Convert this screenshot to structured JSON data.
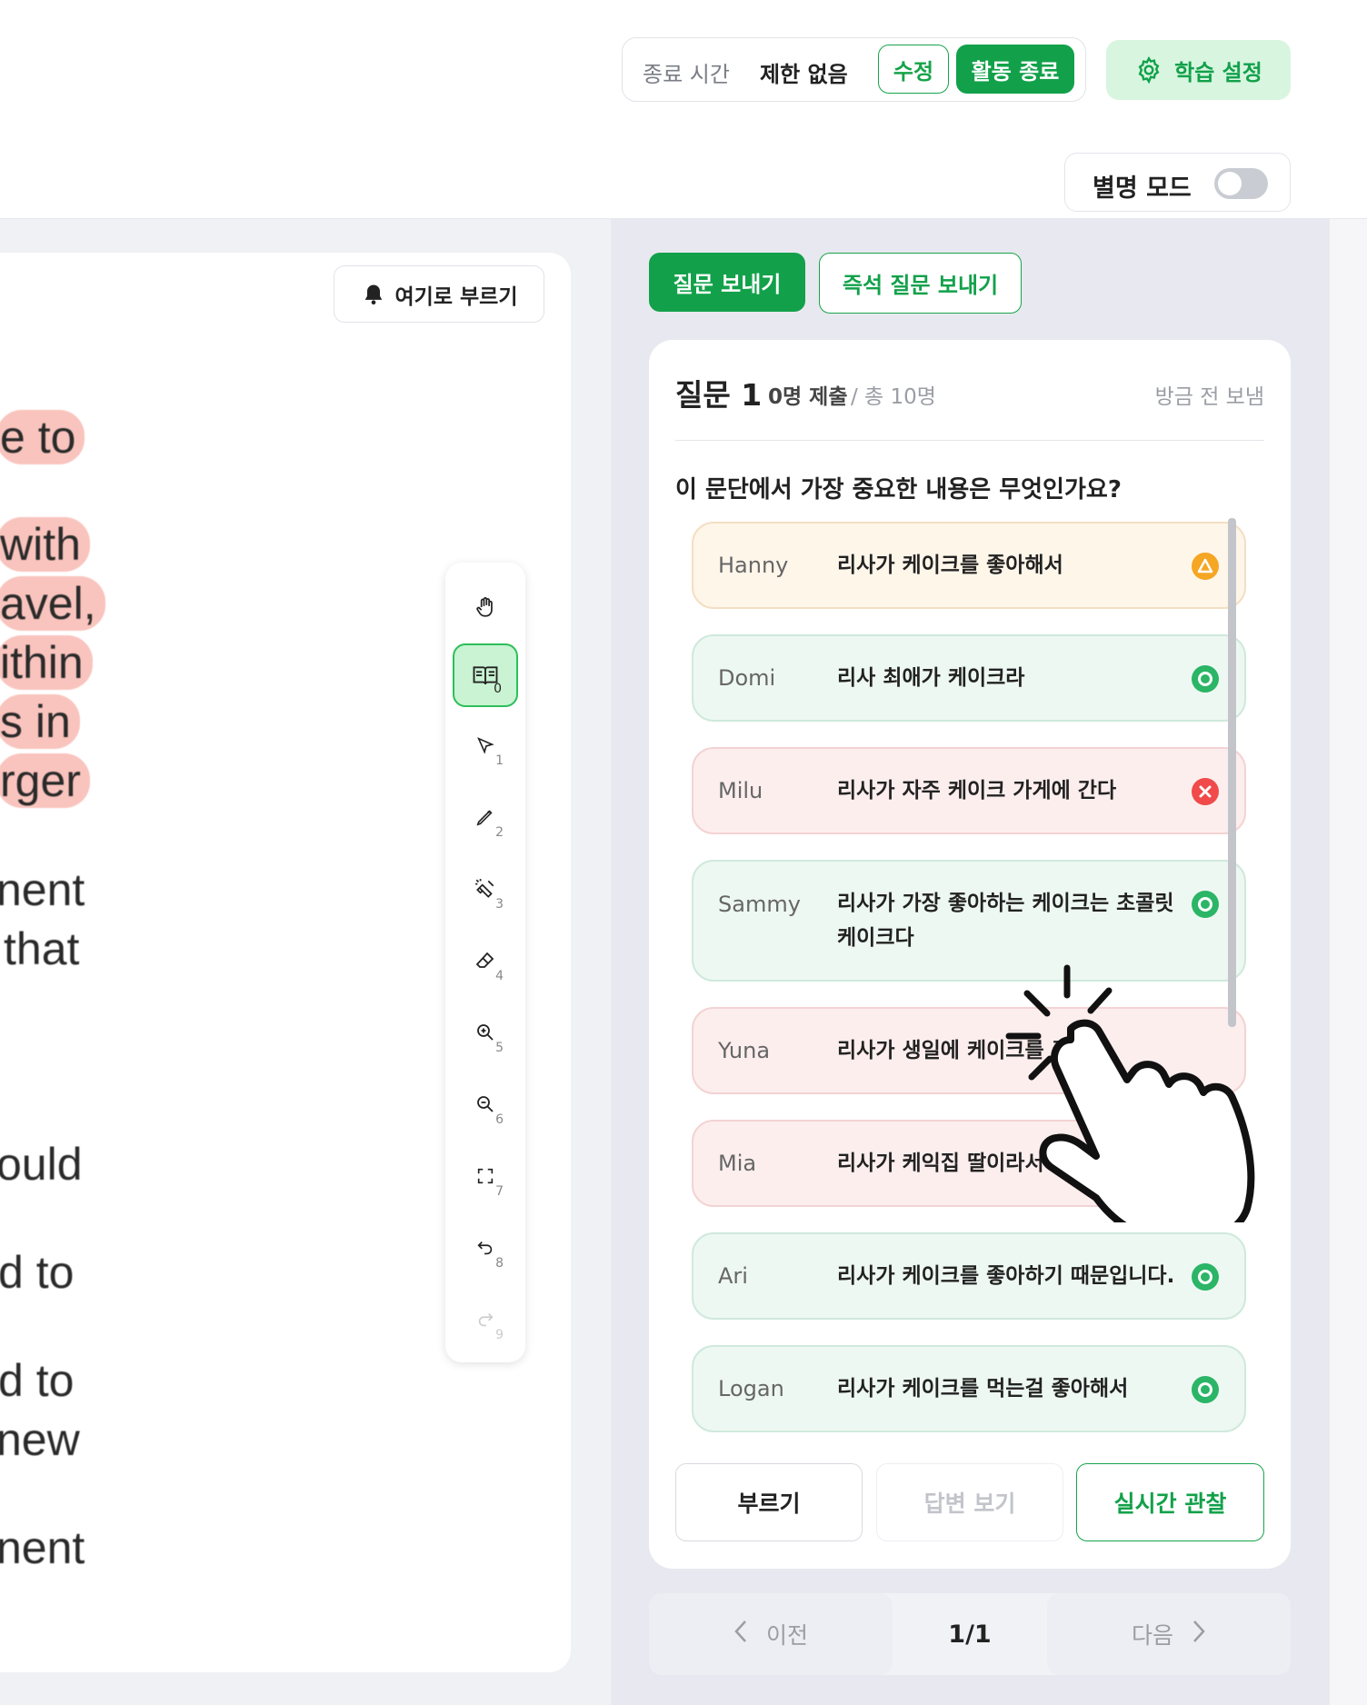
{
  "header": {
    "end_time_label": "종료 시간",
    "end_time_value": "제한 없음",
    "edit_label": "수정",
    "end_activity_label": "활동 종료",
    "settings_label": "학습 설정",
    "alias_mode_label": "별명 모드",
    "alias_mode_on": false
  },
  "document": {
    "call_here_label": "여기로 부르기",
    "lines": [
      {
        "text": "e to",
        "highlight": true
      },
      {
        "text": "with",
        "highlight": true
      },
      {
        "text": "avel,",
        "highlight": true
      },
      {
        "text": "ithin",
        "highlight": true
      },
      {
        "text": "s in",
        "highlight": true
      },
      {
        "text": "rger",
        "highlight": true
      },
      {
        "text": "nent",
        "highlight": false
      },
      {
        "text": "that",
        "highlight": false
      },
      {
        "text": "ould",
        "highlight": false
      },
      {
        "text": "d to",
        "highlight": false
      },
      {
        "text": "d to",
        "highlight": false
      },
      {
        "text": "new",
        "highlight": false
      },
      {
        "text": "nent",
        "highlight": false
      }
    ]
  },
  "toolbar": {
    "tools": [
      {
        "icon": "hand-icon",
        "num": ""
      },
      {
        "icon": "book-icon",
        "num": "0",
        "active": true
      },
      {
        "icon": "cursor-icon",
        "num": "1"
      },
      {
        "icon": "pencil-icon",
        "num": "2"
      },
      {
        "icon": "highlighter-icon",
        "num": "3"
      },
      {
        "icon": "eraser-icon",
        "num": "4"
      },
      {
        "icon": "zoom-in-icon",
        "num": "5"
      },
      {
        "icon": "zoom-out-icon",
        "num": "6"
      },
      {
        "icon": "fullscreen-icon",
        "num": "7"
      },
      {
        "icon": "undo-icon",
        "num": "8"
      },
      {
        "icon": "redo-icon",
        "num": "9"
      }
    ]
  },
  "question_panel": {
    "send_question_label": "질문 보내기",
    "quick_question_label": "즉석 질문 보내기",
    "title": "질문 1",
    "submitted": "0명 제출",
    "total": "/ 총 10명",
    "sent_time": "방금 전 보냄",
    "question_text": "이 문단에서 가장 중요한 내용은 무엇인가요?",
    "answers": [
      {
        "name": "Hanny",
        "text": "리사가 케이크를 좋아해서",
        "status": "partial"
      },
      {
        "name": "Domi",
        "text": "리사 최애가 케이크라",
        "status": "correct"
      },
      {
        "name": "Milu",
        "text": "리사가 자주 케이크 가게에 간다",
        "status": "wrong"
      },
      {
        "name": "Sammy",
        "text": "리사가 가장 좋아하는 케이크는 초콜릿 케이크다",
        "status": "correct"
      },
      {
        "name": "Yuna",
        "text": "리사가 생일에 케이크를 주",
        "status": "wrong"
      },
      {
        "name": "Mia",
        "text": "리사가 케익집 딸이라서",
        "status": "wrong"
      },
      {
        "name": "Ari",
        "text": "리사가 케이크를 좋아하기 때문입니다.",
        "status": "correct"
      },
      {
        "name": "Logan",
        "text": "리사가 케이크를 먹는걸 좋아해서",
        "status": "correct"
      }
    ],
    "call_label": "부르기",
    "view_answers_label": "답변 보기",
    "live_observe_label": "실시간 관찰"
  },
  "pager": {
    "prev_label": "이전",
    "page": "1/1",
    "next_label": "다음"
  },
  "colors": {
    "accent": "#12a14a",
    "correct": "#2bb566",
    "wrong": "#f04a4a",
    "partial": "#f5a623"
  }
}
